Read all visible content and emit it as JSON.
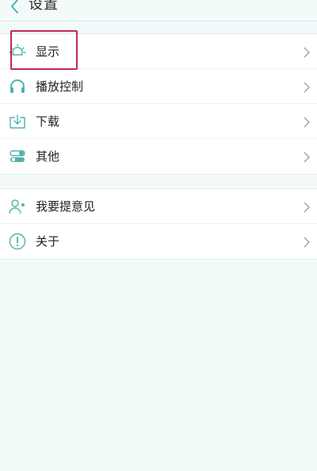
{
  "header": {
    "title": "设置",
    "back_icon": "chevron-left-icon"
  },
  "groups": [
    {
      "items": [
        {
          "label": "显示",
          "icon": "brightness-icon"
        },
        {
          "label": "播放控制",
          "icon": "headphones-icon"
        },
        {
          "label": "下载",
          "icon": "download-icon"
        },
        {
          "label": "其他",
          "icon": "toggles-icon"
        }
      ]
    },
    {
      "items": [
        {
          "label": "我要提意见",
          "icon": "user-feedback-icon"
        },
        {
          "label": "关于",
          "icon": "info-icon"
        }
      ]
    }
  ],
  "colors": {
    "accent": "#4fb3ad",
    "highlight_border": "#c0294f",
    "background": "#f3fafa"
  }
}
